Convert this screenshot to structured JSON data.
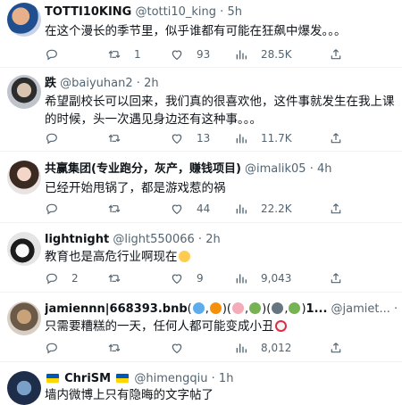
{
  "tweets": [
    {
      "name": "TOTTI10KING",
      "handle": "@totti10_king",
      "time": "5h",
      "text": "在这个漫长的季节里，似乎谁都有可能在狂飙中爆发。。。",
      "replies": "",
      "retweets": "1",
      "likes": "93",
      "views": "28.5K"
    },
    {
      "name": "跌",
      "handle": "@baiyuhan2",
      "time": "2h",
      "text": "希望副校长可以回来，我们真的很喜欢他，这件事就发生在我上课的时候，头一次遇见身边还有这种事。。。",
      "replies": "",
      "retweets": "",
      "likes": "13",
      "views": "11.7K"
    },
    {
      "name": "共赢集团(专业跑分，灰产，赚钱项目)",
      "handle": "@imalik05",
      "time": "4h",
      "text": "已经开始甩锅了，都是游戏惹的祸",
      "replies": "",
      "retweets": "",
      "likes": "44",
      "views": "22.2K"
    },
    {
      "name": "lightnight",
      "handle": "@light550066",
      "time": "2h",
      "text": "教育也是高危行业啊现在",
      "emoji_after_text": "sad-face-emoji",
      "replies": "2",
      "retweets": "",
      "likes": "9",
      "views": "9,043"
    },
    {
      "name": "jamiennn|668393.bnb",
      "name_tail": "1...",
      "handle": "@jamiet...",
      "time": "2h",
      "text": "只需要糟糕的一天，任何人都可能变成小丑",
      "emoji_after_text": "clown-face-emoji",
      "replies": "",
      "retweets": "",
      "likes": "",
      "views": "8,012"
    },
    {
      "name": "ChriSM",
      "handle": "@himengqiu",
      "time": "1h",
      "text": "墙内微博上只有隐晦的文字帖了"
    }
  ],
  "icons": {
    "reply": "reply-icon",
    "retweet": "retweet-icon",
    "like": "heart-icon",
    "views": "views-icon"
  },
  "colors": {
    "text": "#0f1419",
    "secondary": "#536471",
    "divider": "#eff3f4"
  }
}
